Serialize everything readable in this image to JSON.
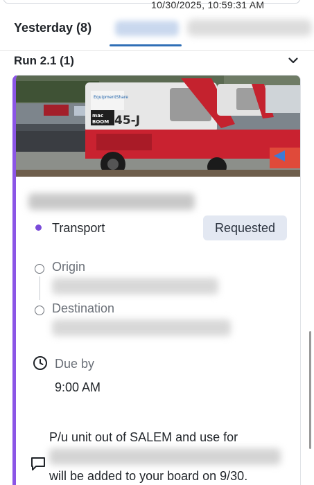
{
  "header": {
    "timestamp": "10/30/2025, 10:59:31 AM",
    "tabs": [
      {
        "label": "Yesterday (8)"
      }
    ]
  },
  "run": {
    "title": "Run 2.1 (1)"
  },
  "card": {
    "accent_color": "#8b55e6",
    "photo_caption": "EquipmentShare",
    "photo_model": "45-J",
    "transport_label": "Transport",
    "status": "Requested",
    "origin_label": "Origin",
    "destination_label": "Destination",
    "due_label": "Due by",
    "due_time": "9:00 AM",
    "note_line1": "P/u unit out of SALEM and use for",
    "note_line3": "will be added to your board on 9/30."
  },
  "icons": {
    "collapse": "chevron-down-icon",
    "due": "clock-icon",
    "comment": "comment-icon"
  }
}
